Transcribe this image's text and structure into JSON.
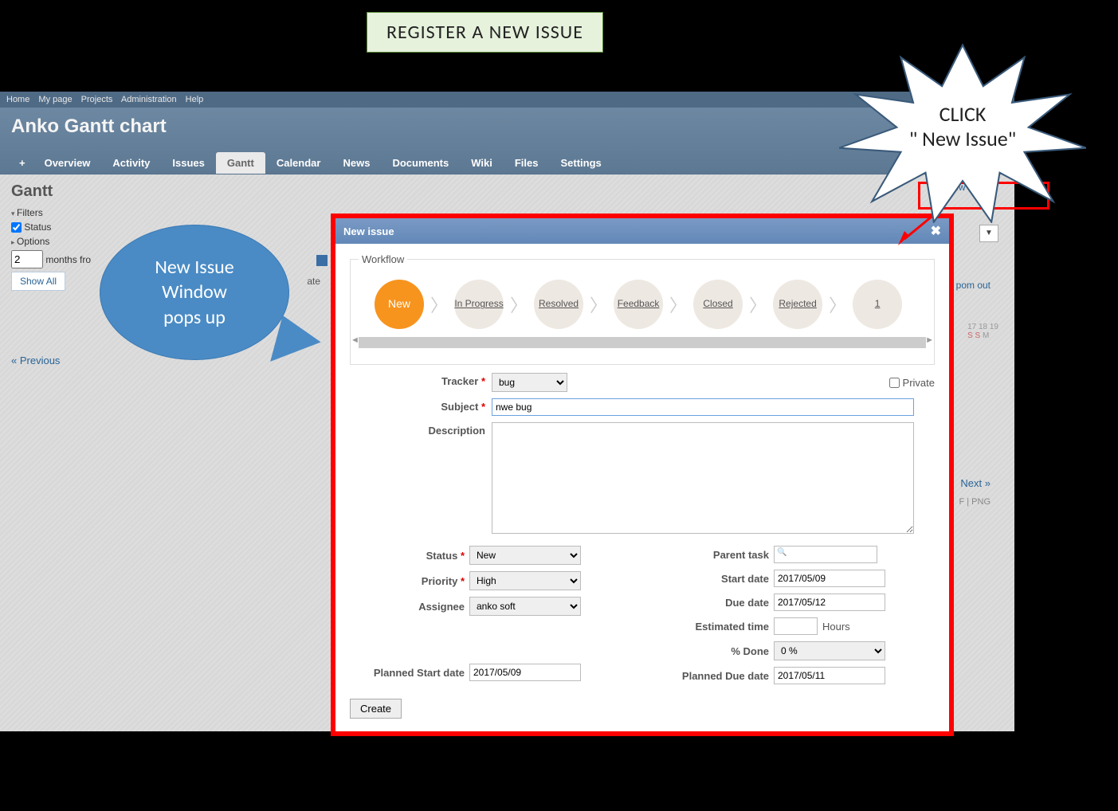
{
  "slide_title": "REGISTER A NEW ISSUE",
  "burst_text_line1": "CLICK",
  "burst_text_line2": "\" New Issue\"",
  "bubble_line1": "New Issue",
  "bubble_line2": "Window",
  "bubble_line3": "pops up",
  "top_menu": [
    "Home",
    "My page",
    "Projects",
    "Administration",
    "Help"
  ],
  "project_title": "Anko Gantt chart",
  "main_tabs": {
    "plus": "+",
    "items": [
      "Overview",
      "Activity",
      "Issues",
      "Gantt",
      "Calendar",
      "News",
      "Documents",
      "Wiki",
      "Files",
      "Settings"
    ],
    "selected": "Gantt"
  },
  "page_heading": "Gantt",
  "filters_label": "Filters",
  "status_label": "Status",
  "options_label": "Options",
  "months_value": "2",
  "months_label": "months fro",
  "show_all": "Show All",
  "date_cut": "ate",
  "previous": "« Previous",
  "next": "Next »",
  "export": "F | PNG",
  "zoom_out": "pom out",
  "cal_days": [
    "17",
    "18",
    "19"
  ],
  "cal_dow": [
    "S",
    "S",
    "M"
  ],
  "new_issue_link": "New issue",
  "dialog": {
    "title": "New issue",
    "workflow_legend": "Workflow",
    "workflow_steps": [
      "New",
      "In Progress",
      "Resolved",
      "Feedback",
      "Closed",
      "Rejected",
      "1"
    ],
    "labels": {
      "tracker": "Tracker",
      "subject": "Subject",
      "description": "Description",
      "private": "Private",
      "status": "Status",
      "priority": "Priority",
      "assignee": "Assignee",
      "parent_task": "Parent task",
      "start_date": "Start date",
      "due_date": "Due date",
      "estimated_time": "Estimated time",
      "hours": "Hours",
      "pct_done": "% Done",
      "planned_start": "Planned Start date",
      "planned_due": "Planned Due date"
    },
    "values": {
      "tracker": "bug",
      "subject": "nwe bug",
      "description": "",
      "status": "New",
      "priority": "High",
      "assignee": "anko soft",
      "parent_task": "",
      "start_date": "2017/05/09",
      "due_date": "2017/05/12",
      "estimated_time": "",
      "pct_done": "0 %",
      "planned_start": "2017/05/09",
      "planned_due": "2017/05/11"
    },
    "create_button": "Create"
  }
}
